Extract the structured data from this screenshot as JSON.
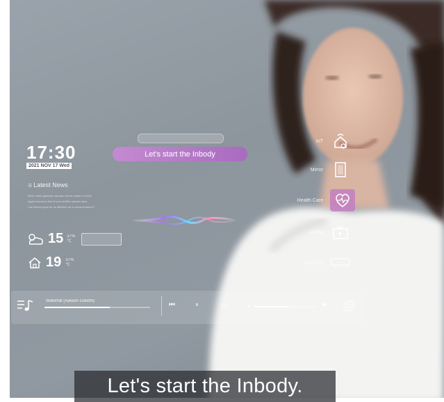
{
  "clock": {
    "time": "17:30",
    "date": "2021 NOV 17 Wed"
  },
  "news": {
    "title": "Latest News",
    "lines": [
      "WHO chief optimistic disease will be beaten in 2022",
      "Apple becomes first firm to hit $3tn market value",
      "Can fitness apps be as effective as a personal trainer?"
    ]
  },
  "weather": {
    "outdoor_temp": "15",
    "outdoor_humidity": "37%",
    "unit": "℃"
  },
  "indoor": {
    "temp": "19",
    "humidity": "37%",
    "unit": "℃"
  },
  "prompt": {
    "main": "Let's start the Inbody"
  },
  "menu": [
    {
      "label": "IoT",
      "icon": "home-icon",
      "active": false
    },
    {
      "label": "Mirror",
      "icon": "mirror-icon",
      "active": false
    },
    {
      "label": "Health Care",
      "icon": "heart-icon",
      "active": true
    },
    {
      "label": "Media",
      "icon": "tv-icon",
      "active": false
    },
    {
      "label": "Stand By",
      "icon": "standby-icon",
      "active": false
    }
  ],
  "player": {
    "song": "Waterfall (Aakash Gandhi)",
    "progress": 0.62,
    "volume": 0.55
  },
  "caption": {
    "text": "Let's start the Inbody."
  },
  "colors": {
    "accent": "#c27ac4",
    "pill": "#b47bc7"
  }
}
